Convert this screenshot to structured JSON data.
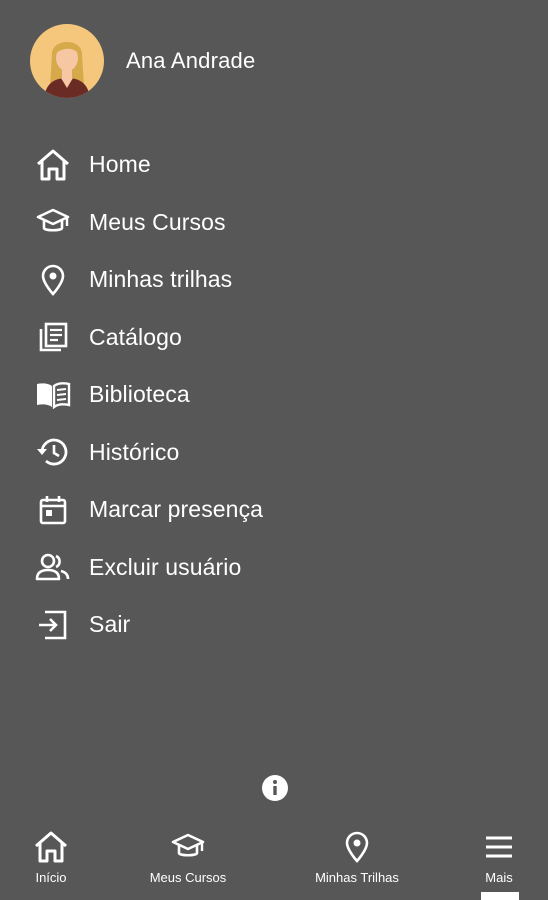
{
  "profile": {
    "name": "Ana Andrade"
  },
  "menu": {
    "items": [
      {
        "label": "Home",
        "icon": "home-icon"
      },
      {
        "label": "Meus Cursos",
        "icon": "graduation-cap-icon"
      },
      {
        "label": "Minhas trilhas",
        "icon": "location-pin-icon"
      },
      {
        "label": "Catálogo",
        "icon": "catalog-icon"
      },
      {
        "label": "Biblioteca",
        "icon": "book-icon"
      },
      {
        "label": "Histórico",
        "icon": "history-icon"
      },
      {
        "label": "Marcar presença",
        "icon": "calendar-icon"
      },
      {
        "label": "Excluir usuário",
        "icon": "users-icon"
      },
      {
        "label": "Sair",
        "icon": "exit-icon"
      }
    ]
  },
  "bottom_nav": {
    "items": [
      {
        "label": "Início",
        "icon": "home-icon"
      },
      {
        "label": "Meus Cursos",
        "icon": "graduation-cap-icon"
      },
      {
        "label": "Minhas Trilhas",
        "icon": "location-pin-icon"
      },
      {
        "label": "Mais",
        "icon": "hamburger-menu-icon",
        "active": true
      }
    ]
  },
  "colors": {
    "background": "#575757",
    "text": "#ffffff",
    "avatar_bg": "#f4c77d"
  }
}
